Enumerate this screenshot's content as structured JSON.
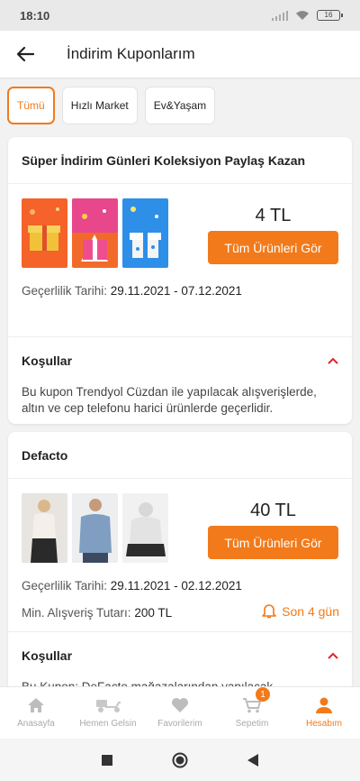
{
  "status_bar": {
    "time": "18:10",
    "battery": "16"
  },
  "header": {
    "title": "İndirim Kuponlarım"
  },
  "filters": [
    {
      "label": "Tümü",
      "active": true
    },
    {
      "label": "Hızlı Market",
      "active": false
    },
    {
      "label": "Ev&Yaşam",
      "active": false
    }
  ],
  "coupons": [
    {
      "title": "Süper İndirim Günleri Koleksiyon Paylaş Kazan",
      "amount": "4 TL",
      "button": "Tüm Ürünleri Gör",
      "validity_label": "Geçerlilik Tarihi:",
      "validity_dates": "29.11.2021 - 07.12.2021",
      "conditions_title": "Koşullar",
      "conditions_text": "Bu kupon Trendyol Cüzdan ile yapılacak alışverişlerde, altın ve cep telefonu harici ürünlerde geçerlidir."
    },
    {
      "title": "Defacto",
      "amount": "40 TL",
      "button": "Tüm Ürünleri Gör",
      "validity_label": "Geçerlilik Tarihi:",
      "validity_dates": "29.11.2021 - 02.12.2021",
      "min_label": "Min. Alışveriş Tutarı:",
      "min_value": "200 TL",
      "remaining": "Son 4 gün",
      "conditions_title": "Koşullar",
      "conditions_text": "Bu Kupon; DeFacto mağazalarından yapılacak"
    }
  ],
  "bottom_nav": [
    {
      "label": "Anasayfa",
      "icon": "home-icon",
      "active": false
    },
    {
      "label": "Hemen Gelsin",
      "icon": "scooter-icon",
      "active": false
    },
    {
      "label": "Favorilerim",
      "icon": "heart-icon",
      "active": false
    },
    {
      "label": "Sepetim",
      "icon": "cart-icon",
      "active": false,
      "badge": "1"
    },
    {
      "label": "Hesabım",
      "icon": "user-icon",
      "active": true
    }
  ],
  "colors": {
    "accent": "#f27a1a",
    "background": "#f2f2f2"
  }
}
